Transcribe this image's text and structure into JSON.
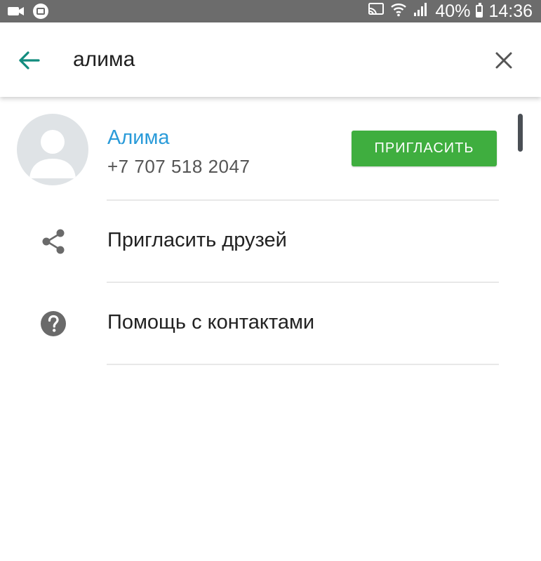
{
  "status_bar": {
    "battery": "40%",
    "time": "14:36",
    "battery_level": 0.4,
    "icons": [
      "video-icon",
      "notification-icon",
      "cast-icon",
      "wifi-icon",
      "signal-icon",
      "battery-icon"
    ]
  },
  "search": {
    "query": "алима",
    "back_icon": "arrow-left-icon",
    "clear_icon": "close-icon"
  },
  "contact": {
    "name": "Алима",
    "phone": "+7 707 518 2047",
    "invite_label": "ПРИГЛАСИТЬ"
  },
  "actions": [
    {
      "label": "Пригласить друзей",
      "icon": "share-icon"
    },
    {
      "label": "Помощь с контактами",
      "icon": "help-icon"
    }
  ],
  "colors": {
    "accent_teal": "#128c7e",
    "name_blue": "#2a9bd9",
    "invite_green": "#3fae3f",
    "status_bar": "#6c6c6c"
  }
}
